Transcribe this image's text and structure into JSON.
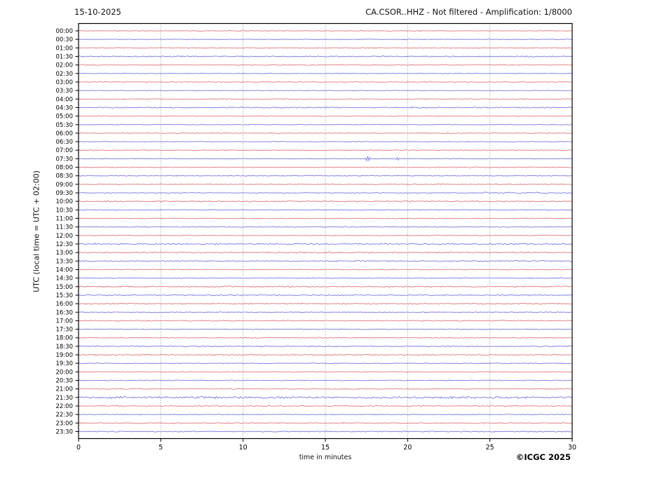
{
  "header": {
    "date": "15-10-2025",
    "title": "CA.CSOR..HHZ - Not filtered - Amplification: 1/8000"
  },
  "footer": {
    "copyright": "©ICGC 2025"
  },
  "chart_data": {
    "type": "line",
    "variant": "helicorder-seismogram",
    "title": "CA.CSOR..HHZ - Not filtered - Amplification: 1/8000",
    "date": "15-10-2025",
    "xlabel": "time in minutes",
    "ylabel": "UTC (local time = UTC + 02:00)",
    "xlim": [
      0,
      30
    ],
    "x_ticks": [
      0,
      5,
      10,
      15,
      20,
      25,
      30
    ],
    "x_gridlines": [
      5,
      10,
      15,
      20,
      25
    ],
    "grid": true,
    "legend": "none",
    "colors": {
      "hour_trace": "#e06a6a",
      "half_hour_trace": "#6a6ae0",
      "axis": "#000000",
      "grid": "#808080",
      "background": "#ffffff"
    },
    "rows": [
      {
        "label": "00:00",
        "color": "hour",
        "noise_amp": 0.6
      },
      {
        "label": "00:30",
        "color": "half",
        "noise_amp": 0.6
      },
      {
        "label": "01:00",
        "color": "hour",
        "noise_amp": 0.6
      },
      {
        "label": "01:30",
        "color": "half",
        "noise_amp": 1.0
      },
      {
        "label": "02:00",
        "color": "hour",
        "noise_amp": 0.7
      },
      {
        "label": "02:30",
        "color": "half",
        "noise_amp": 0.6
      },
      {
        "label": "03:00",
        "color": "hour",
        "noise_amp": 0.7
      },
      {
        "label": "03:30",
        "color": "half",
        "noise_amp": 0.6
      },
      {
        "label": "04:00",
        "color": "hour",
        "noise_amp": 0.7
      },
      {
        "label": "04:30",
        "color": "half",
        "noise_amp": 1.0
      },
      {
        "label": "05:00",
        "color": "hour",
        "noise_amp": 0.6
      },
      {
        "label": "05:30",
        "color": "half",
        "noise_amp": 0.6
      },
      {
        "label": "06:00",
        "color": "hour",
        "noise_amp": 0.7
      },
      {
        "label": "06:30",
        "color": "half",
        "noise_amp": 0.6
      },
      {
        "label": "07:00",
        "color": "hour",
        "noise_amp": 0.7
      },
      {
        "label": "07:30",
        "color": "half",
        "noise_amp": 0.6
      },
      {
        "label": "08:00",
        "color": "hour",
        "noise_amp": 0.7
      },
      {
        "label": "08:30",
        "color": "half",
        "noise_amp": 0.6
      },
      {
        "label": "09:00",
        "color": "hour",
        "noise_amp": 0.7
      },
      {
        "label": "09:30",
        "color": "half",
        "noise_amp": 0.7
      },
      {
        "label": "10:00",
        "color": "hour",
        "noise_amp": 1.0
      },
      {
        "label": "10:30",
        "color": "half",
        "noise_amp": 0.6
      },
      {
        "label": "11:00",
        "color": "hour",
        "noise_amp": 0.6
      },
      {
        "label": "11:30",
        "color": "half",
        "noise_amp": 0.7
      },
      {
        "label": "12:00",
        "color": "hour",
        "noise_amp": 0.6
      },
      {
        "label": "12:30",
        "color": "half",
        "noise_amp": 1.2
      },
      {
        "label": "13:00",
        "color": "hour",
        "noise_amp": 1.1
      },
      {
        "label": "13:30",
        "color": "half",
        "noise_amp": 1.0
      },
      {
        "label": "14:00",
        "color": "hour",
        "noise_amp": 0.7
      },
      {
        "label": "14:30",
        "color": "half",
        "noise_amp": 0.7
      },
      {
        "label": "15:00",
        "color": "hour",
        "noise_amp": 1.1
      },
      {
        "label": "15:30",
        "color": "half",
        "noise_amp": 0.9
      },
      {
        "label": "16:00",
        "color": "hour",
        "noise_amp": 1.0
      },
      {
        "label": "16:30",
        "color": "half",
        "noise_amp": 0.7
      },
      {
        "label": "17:00",
        "color": "hour",
        "noise_amp": 0.9
      },
      {
        "label": "17:30",
        "color": "half",
        "noise_amp": 0.7
      },
      {
        "label": "18:00",
        "color": "hour",
        "noise_amp": 0.7
      },
      {
        "label": "18:30",
        "color": "half",
        "noise_amp": 1.0
      },
      {
        "label": "19:00",
        "color": "hour",
        "noise_amp": 1.0
      },
      {
        "label": "19:30",
        "color": "half",
        "noise_amp": 0.7
      },
      {
        "label": "20:00",
        "color": "hour",
        "noise_amp": 0.7
      },
      {
        "label": "20:30",
        "color": "half",
        "noise_amp": 0.7
      },
      {
        "label": "21:00",
        "color": "hour",
        "noise_amp": 0.7
      },
      {
        "label": "21:30",
        "color": "half",
        "noise_amp": 1.8
      },
      {
        "label": "22:00",
        "color": "hour",
        "noise_amp": 1.0
      },
      {
        "label": "22:30",
        "color": "half",
        "noise_amp": 0.7
      },
      {
        "label": "23:00",
        "color": "hour",
        "noise_amp": 0.8
      },
      {
        "label": "23:30",
        "color": "half",
        "noise_amp": 0.9
      }
    ],
    "events": [
      {
        "row": "07:30",
        "type": "spike",
        "minute": 17.6,
        "amp": 4.5,
        "width_min": 0.22
      },
      {
        "row": "07:30",
        "type": "spike",
        "minute": 19.4,
        "amp": 2.0,
        "width_min": 0.15
      },
      {
        "row": "09:30",
        "type": "burst",
        "start_min": 24.3,
        "end_min": 28.6,
        "amp": 1.3
      },
      {
        "row": "10:00",
        "type": "burst",
        "start_min": 1.0,
        "end_min": 3.2,
        "amp": 1.2
      }
    ]
  }
}
